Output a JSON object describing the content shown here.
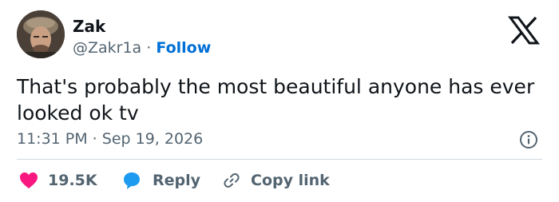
{
  "author": {
    "name": "Zak",
    "handle": "@Zakr1a",
    "separator": "·",
    "follow_label": "Follow"
  },
  "tweet": {
    "text": "That's probably the most beautiful anyone has ever looked ok tv",
    "timestamp": "11:31 PM · Sep 19, 2026"
  },
  "actions": {
    "likes_count": "19.5K",
    "reply_label": "Reply",
    "copy_link_label": "Copy link"
  },
  "icons": {
    "brand": "x-logo-icon",
    "info": "info-icon",
    "like": "heart-icon",
    "reply": "speech-bubble-icon",
    "copy": "link-icon"
  },
  "colors": {
    "accent": "#006fd6",
    "like": "#f91880",
    "reply": "#1d9bf0",
    "muted": "#536471",
    "text": "#0f1419"
  }
}
